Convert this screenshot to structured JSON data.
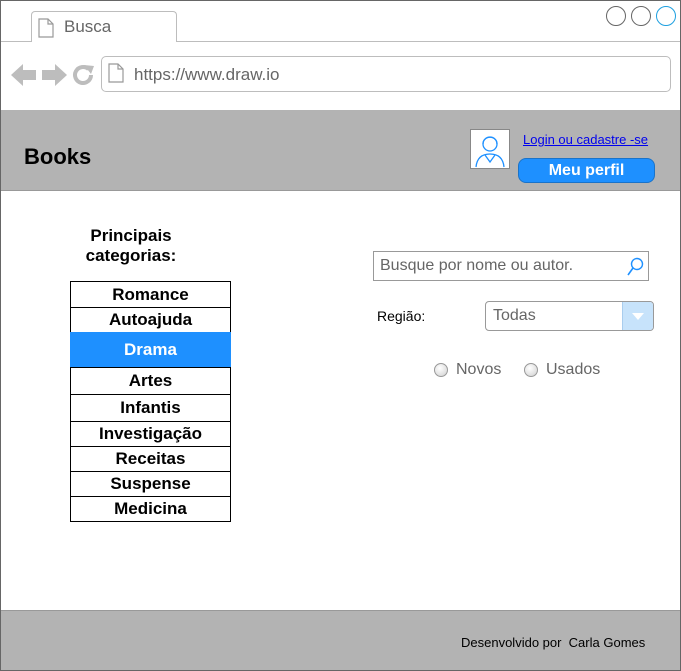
{
  "browser": {
    "tab_title": "Busca",
    "url": "https://www.draw.io"
  },
  "header": {
    "brand": "Books",
    "login_link": "Login ou cadastre -se",
    "profile_button": "Meu perfil"
  },
  "categories": {
    "title_line1": "Principais",
    "title_line2": "categorias:",
    "items": [
      {
        "label": "Romance"
      },
      {
        "label": "Autoajuda"
      },
      {
        "label": "Drama",
        "selected": true
      },
      {
        "label": "Artes"
      },
      {
        "label": "Infantis"
      },
      {
        "label": "Investigação"
      },
      {
        "label": "Receitas"
      },
      {
        "label": "Suspense"
      },
      {
        "label": "Medicina"
      }
    ]
  },
  "search": {
    "placeholder": "Busque por nome ou autor."
  },
  "filters": {
    "region_label": "Região:",
    "region_value": "Todas",
    "radio_new": "Novos",
    "radio_used": "Usados"
  },
  "footer": {
    "credit": "Desenvolvido por  Carla Gomes"
  },
  "colors": {
    "accent": "#1e90ff",
    "header_bg": "#b3b3b3"
  }
}
